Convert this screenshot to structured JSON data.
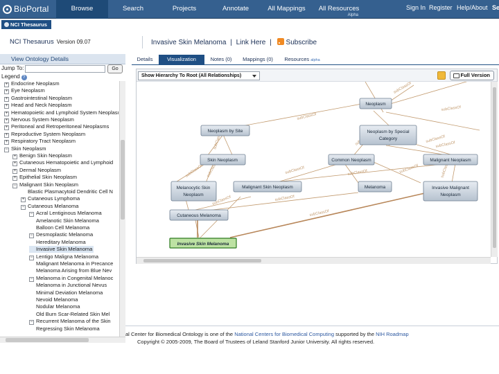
{
  "topnav": {
    "logo_text": "BioPortal",
    "tabs": [
      {
        "label": "Browse",
        "active": true
      },
      {
        "label": "Search",
        "active": false
      },
      {
        "label": "Projects",
        "active": false
      },
      {
        "label": "Annotate",
        "active": false
      },
      {
        "label": "All Mappings",
        "active": false
      },
      {
        "label": "All Resources",
        "sub": "Alpha",
        "active": false
      }
    ],
    "sign_in": "Sign In",
    "register": "Register",
    "help_about": "Help/About",
    "cut_link": "Se"
  },
  "ontology_tab": {
    "label": "NCI Thesaurus"
  },
  "header": {
    "ontology_name": "NCI Thesaurus",
    "version": "Version 09.07",
    "term": "Invasive Skin Melanoma",
    "separator": "|",
    "link_here": "Link Here",
    "subscribe": "Subscribe"
  },
  "left_panel": {
    "view_details": "View Ontology Details",
    "jump_label": "Jump To:",
    "go_label": "Go",
    "legend_label": "Legend",
    "tree": [
      {
        "label": "Endocrine Neoplasm",
        "toggle": "+",
        "depth": 0
      },
      {
        "label": "Eye Neoplasm",
        "toggle": "+",
        "depth": 0
      },
      {
        "label": "Gastrointestinal Neoplasm",
        "toggle": "+",
        "depth": 0
      },
      {
        "label": "Head and Neck Neoplasm",
        "toggle": "+",
        "depth": 0
      },
      {
        "label": "Hematopoietic and Lymphoid System Neoplasm",
        "toggle": "+",
        "depth": 0
      },
      {
        "label": "Nervous System Neoplasm",
        "toggle": "+",
        "depth": 0
      },
      {
        "label": "Peritoneal and Retroperitoneal Neoplasms",
        "toggle": "+",
        "depth": 0
      },
      {
        "label": "Reproductive System Neoplasm",
        "toggle": "+",
        "depth": 0
      },
      {
        "label": "Respiratory Tract Neoplasm",
        "toggle": "+",
        "depth": 0
      },
      {
        "label": "Skin Neoplasm",
        "toggle": "-",
        "depth": 0
      },
      {
        "label": "Benign Skin Neoplasm",
        "toggle": "+",
        "depth": 1
      },
      {
        "label": "Cutaneous Hematopoietic and Lymphoid",
        "toggle": "+",
        "depth": 1
      },
      {
        "label": "Dermal Neoplasm",
        "toggle": "+",
        "depth": 1
      },
      {
        "label": "Epithelial Skin Neoplasm",
        "toggle": "+",
        "depth": 1
      },
      {
        "label": "Malignant Skin Neoplasm",
        "toggle": "-",
        "depth": 1
      },
      {
        "label": "Blastic Plasmacytoid Dendritic Cell N",
        "toggle": "",
        "depth": 2
      },
      {
        "label": "Cutaneous Lymphoma",
        "toggle": "+",
        "depth": 2
      },
      {
        "label": "Cutaneous Melanoma",
        "toggle": "-",
        "depth": 2
      },
      {
        "label": "Acral Lentiginous Melanoma",
        "toggle": "-",
        "depth": 3
      },
      {
        "label": "Amelanotic Skin Melanoma",
        "toggle": "",
        "depth": 3
      },
      {
        "label": "Balloon Cell Melanoma",
        "toggle": "",
        "depth": 3
      },
      {
        "label": "Desmoplastic Melanoma",
        "toggle": "-",
        "depth": 3
      },
      {
        "label": "Hereditary Melanoma",
        "toggle": "",
        "depth": 3
      },
      {
        "label": "Invasive Skin Melanoma",
        "toggle": "",
        "depth": 3,
        "selected": true
      },
      {
        "label": "Lentigo Maligna Melanoma",
        "toggle": "-",
        "depth": 3
      },
      {
        "label": "Malignant Melanoma in Precance",
        "toggle": "",
        "depth": 3
      },
      {
        "label": "Melanoma Arising from Blue Nev",
        "toggle": "",
        "depth": 3
      },
      {
        "label": "Melanoma in Congenital Melanoc",
        "toggle": "-",
        "depth": 3
      },
      {
        "label": "Melanoma in Junctional Nevus",
        "toggle": "",
        "depth": 3
      },
      {
        "label": "Minimal Deviation Melanoma",
        "toggle": "",
        "depth": 3
      },
      {
        "label": "Nevoid Melanoma",
        "toggle": "",
        "depth": 3
      },
      {
        "label": "Nodular Melanoma",
        "toggle": "",
        "depth": 3
      },
      {
        "label": "Old Burn Scar-Related Skin Mel",
        "toggle": "",
        "depth": 3
      },
      {
        "label": "Recurrent Melanoma of the Skin",
        "toggle": "-",
        "depth": 3
      },
      {
        "label": "Regressing Skin Melanoma",
        "toggle": "",
        "depth": 3
      }
    ]
  },
  "content_tabs": [
    {
      "label": "Details",
      "active": false
    },
    {
      "label": "Visualization",
      "active": true
    },
    {
      "label": "Notes (0)",
      "active": false
    },
    {
      "label": "Mappings (0)",
      "active": false
    },
    {
      "label": "Resources",
      "sup": "alpha",
      "active": false
    }
  ],
  "visualization": {
    "hierarchy_select": "Show Hierarchy To Root (All Relationships)",
    "full_version": "Full Version",
    "nodes": {
      "neoplasm": "Neoplasm",
      "neoplasm_by_site": "Neoplasm by Site",
      "neoplasm_by_special_category_1": "Neoplasm by Special",
      "neoplasm_by_special_category_2": "Category",
      "skin_neoplasm": "Skin Neoplasm",
      "common_neoplasm": "Common Neoplasm",
      "malignant_neoplasm": "Malignant Neoplasm",
      "melanocytic_skin_neoplasm_1": "Melanocytic Skin",
      "melanocytic_skin_neoplasm_2": "Neoplasm",
      "malignant_skin_neoplasm": "Malignant Skin Neoplasm",
      "melanoma": "Melanoma",
      "invasive_malignant_neoplasm_1": "Invasive Malignant",
      "invasive_malignant_neoplasm_2": "Neoplasm",
      "cutaneous_melanoma": "Cutaneous Melanoma",
      "invasive_skin_melanoma": "Invasive Skin Melanoma"
    },
    "edge_label": "subClassOf"
  },
  "footer": {
    "line1_cut": "al",
    "line1_org": "Center for Biomedical Ontology is one of the",
    "line1_link": "National Centers for Biomedical Computing",
    "line1_mid": "supported by the",
    "line1_link2": "NIH Roadmap",
    "line2": "Copyright © 2005-2009, The Board of Trustees of Leland Stanford Junior University. All rights reserved."
  }
}
